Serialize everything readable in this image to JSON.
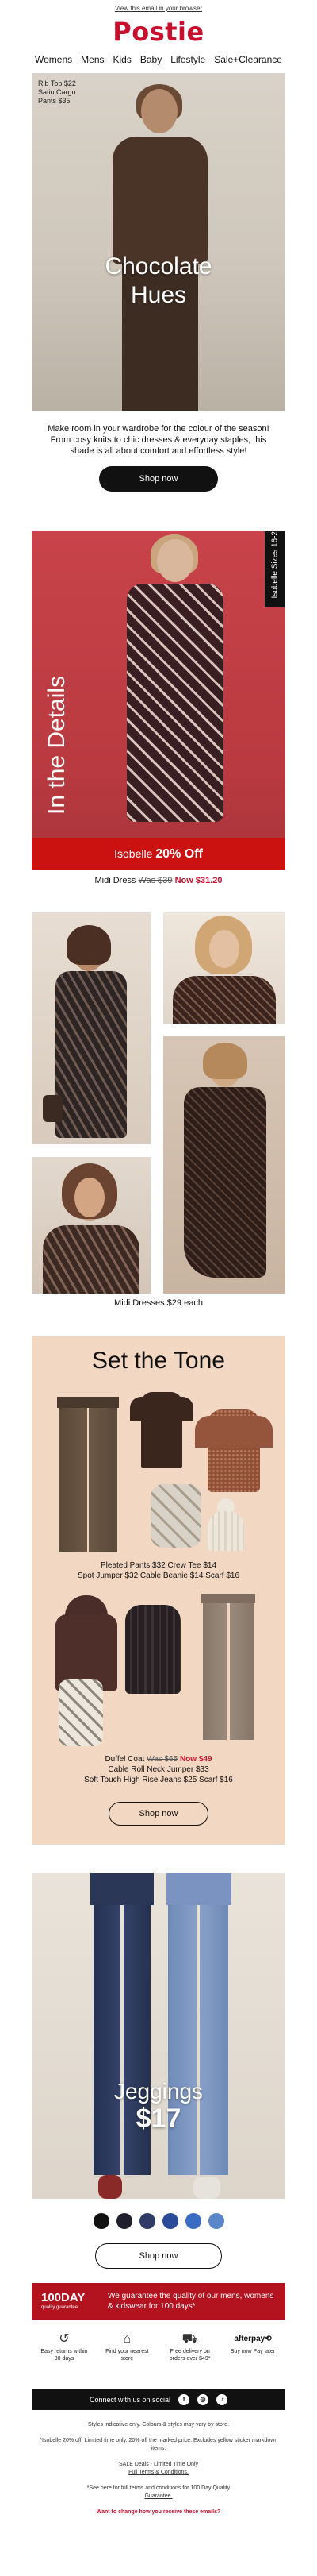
{
  "header": {
    "browser_link": "View this email in your browser",
    "logo": "Postie",
    "nav": [
      "Womens",
      "Mens",
      "Kids",
      "Baby",
      "Lifestyle",
      "Sale+Clearance"
    ]
  },
  "hero": {
    "price_tags": [
      "Rib Top $22",
      "Satin Cargo",
      "Pants $35"
    ],
    "title_line1": "Chocolate",
    "title_line2": "Hues",
    "intro": "Make room in your wardrobe for the colour of the season! From cosy knits to chic dresses & everyday staples, this shade is all about comfort and effortless style!",
    "cta": "Shop now"
  },
  "promo": {
    "vertical_title": "In the Details",
    "brand_tab": "Isobelle Sizes 16-26",
    "banner_brand": "Isobelle",
    "banner_offer": "20% Off",
    "caption_item": "Midi Dress",
    "caption_was": "Was $39",
    "caption_now": "Now $31.20"
  },
  "grid": {
    "caption": "Midi Dresses $29 each"
  },
  "tone": {
    "heading": "Set the Tone",
    "caption1_line1": "Pleated Pants $32 Crew Tee $14",
    "caption1_line2": "Spot Jumper $32 Cable Beanie $14 Scarf $16",
    "caption2_item": "Duffel Coat",
    "caption2_was": "Was $65",
    "caption2_now": "Now $49",
    "caption2_line2": "Cable Roll Neck Jumper $33",
    "caption2_line3": "Soft Touch High Rise Jeans $25 Scarf $16",
    "cta": "Shop now"
  },
  "jeggings": {
    "title": "Jeggings",
    "price": "$17",
    "swatches": [
      "#111111",
      "#1f1f2e",
      "#2f3a66",
      "#2a4a9a",
      "#3b6cc4",
      "#5b86c9"
    ],
    "cta": "Shop now"
  },
  "guarantee": {
    "badge_big": "100DAY",
    "badge_small": "quality guarantee",
    "message": "We guarantee the quality of our mens, womens & kidswear for 100 days*"
  },
  "services": [
    {
      "icon": "returns-icon",
      "label": "Easy returns within 30 days"
    },
    {
      "icon": "store-icon",
      "label": "Find your nearest store"
    },
    {
      "icon": "delivery-icon",
      "label": "Free delivery on orders over $49*"
    },
    {
      "icon": "afterpay-icon",
      "label": "Buy now Pay later",
      "mark": "afterpay⟲"
    }
  ],
  "social": {
    "label": "Connect with us on social",
    "icons": [
      "f",
      "◎",
      "♪"
    ]
  },
  "footer": {
    "line1": "Styles indicative only. Colours & styles may vary by store.",
    "line2": "^Isobelle 20% off: Limited time only. 20% off the marked price. Excludes yellow sticker markdown items.",
    "line3a": "SALE Deals - Limited Time Only",
    "line3b": "Full Terms & Conditions.",
    "line4a": "*See here for full terms and conditions for 100 Day Quality",
    "line4b": "Guarantee.",
    "line5": "Want to change how you receive these emails?"
  }
}
